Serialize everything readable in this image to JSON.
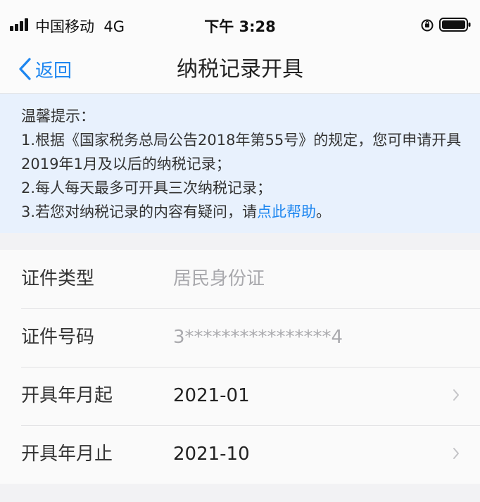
{
  "status_bar": {
    "carrier": "中国移动",
    "network": "4G",
    "time": "下午 3:28"
  },
  "nav": {
    "back_label": "返回",
    "title": "纳税记录开具"
  },
  "notice": {
    "heading": "温馨提示：",
    "line1": "1.根据《国家税务总局公告2018年第55号》的规定，您可申请开具2019年1月及以后的纳税记录；",
    "line2": "2.每人每天最多可开具三次纳税记录；",
    "line3_prefix": "3.若您对纳税记录的内容有疑问，请",
    "line3_link": "点此帮助",
    "line3_suffix": "。"
  },
  "form": {
    "id_type": {
      "label": "证件类型",
      "value": "居民身份证"
    },
    "id_number": {
      "label": "证件号码",
      "value": "3****************4"
    },
    "start_month": {
      "label": "开具年月起",
      "value": "2021-01"
    },
    "end_month": {
      "label": "开具年月止",
      "value": "2021-10"
    }
  },
  "colors": {
    "accent": "#1d86f0",
    "notice_bg": "#e8f1fd",
    "muted_text": "#a9a9ad"
  }
}
